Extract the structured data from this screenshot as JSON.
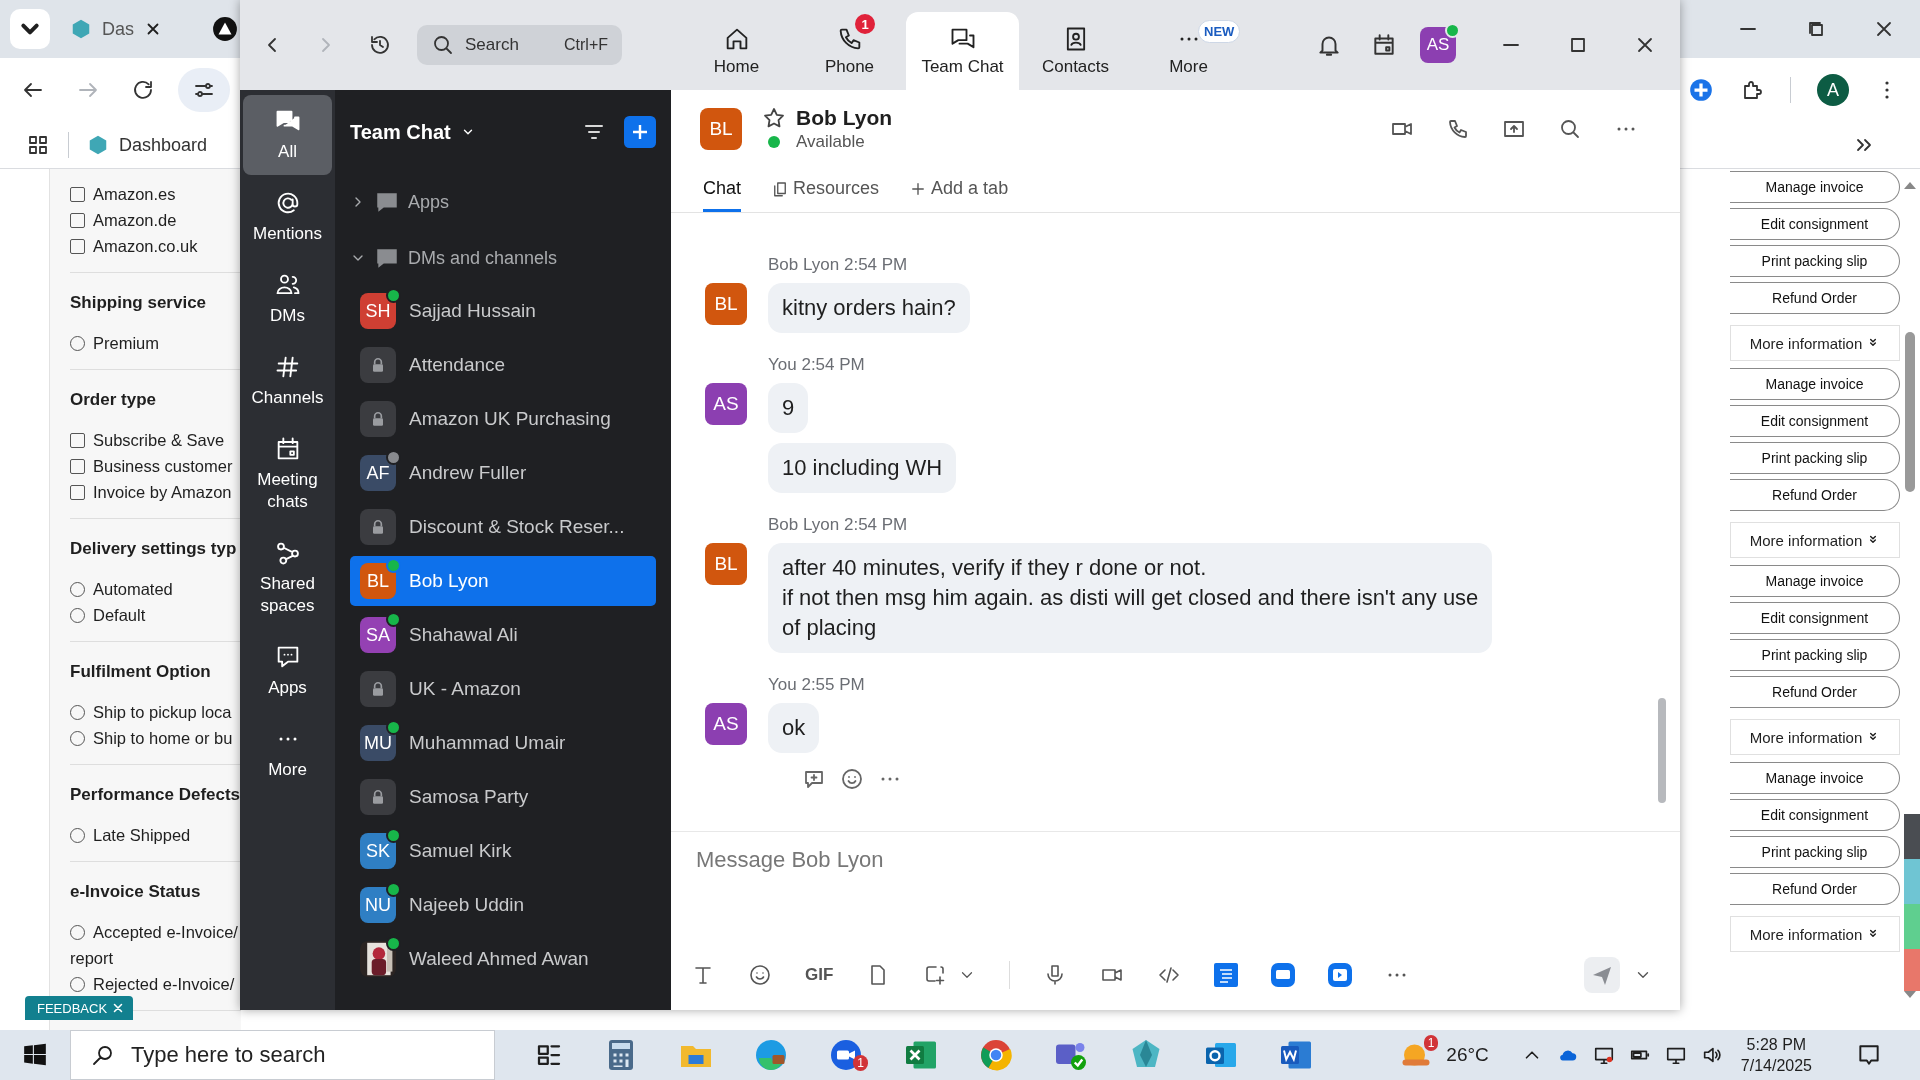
{
  "browser": {
    "tab_label": "Das",
    "bookmark": "Dashboard",
    "profile_initial": "A"
  },
  "filters": [
    {
      "options": [
        {
          "kind": "checkbox",
          "lines": [
            "Amazon.es"
          ],
          "checked": false
        },
        {
          "kind": "checkbox",
          "lines": [
            "Amazon.de"
          ],
          "checked": false
        },
        {
          "kind": "checkbox",
          "lines": [
            "Amazon.co.uk"
          ],
          "checked": false
        }
      ]
    },
    {
      "heading": "Shipping service",
      "options": [
        {
          "kind": "radio",
          "lines": [
            "Premium"
          ],
          "checked": false
        }
      ]
    },
    {
      "heading": "Order type",
      "options": [
        {
          "kind": "checkbox",
          "lines": [
            "Subscribe & Save"
          ],
          "checked": false
        },
        {
          "kind": "checkbox",
          "lines": [
            "Business customer"
          ],
          "checked": false
        },
        {
          "kind": "checkbox",
          "lines": [
            "Invoice by Amazon"
          ],
          "checked": false
        }
      ]
    },
    {
      "heading": "Delivery settings typ",
      "options": [
        {
          "kind": "radio",
          "lines": [
            "Automated"
          ],
          "checked": false
        },
        {
          "kind": "radio",
          "lines": [
            "Default"
          ],
          "checked": false
        }
      ]
    },
    {
      "heading": "Fulfilment Option",
      "options": [
        {
          "kind": "radio",
          "lines": [
            "Ship to pickup loca"
          ],
          "checked": false
        },
        {
          "kind": "radio",
          "lines": [
            "Ship to home or bu"
          ],
          "checked": false
        }
      ]
    },
    {
      "heading": "Performance Defects",
      "options": [
        {
          "kind": "radio",
          "lines": [
            "Late Shipped"
          ],
          "checked": false
        }
      ]
    },
    {
      "heading": "e-Invoice Status",
      "options": [
        {
          "kind": "radio",
          "lines": [
            "Accepted e-Invoice/",
            "report"
          ],
          "checked": false
        },
        {
          "kind": "radio",
          "lines": [
            "Rejected e-Invoice/"
          ],
          "checked": false
        }
      ]
    }
  ],
  "feedback": "FEEDBACK",
  "order_groups": [
    {
      "buttons": [
        "Manage invoice",
        "Edit consignment",
        "Print packing slip",
        "Refund Order"
      ]
    },
    {
      "header": "More information",
      "buttons": [
        "Manage invoice",
        "Edit consignment",
        "Print packing slip",
        "Refund Order"
      ]
    },
    {
      "header": "More information",
      "buttons": [
        "Manage invoice",
        "Edit consignment",
        "Print packing slip",
        "Refund Order"
      ]
    },
    {
      "header": "More information",
      "buttons": [
        "Manage invoice",
        "Edit consignment",
        "Print packing slip",
        "Refund Order"
      ]
    },
    {
      "header": "More information"
    }
  ],
  "zoom": {
    "search": {
      "placeholder": "Search",
      "shortcut": "Ctrl+F"
    },
    "nav": [
      {
        "label": "Home",
        "selected": false
      },
      {
        "label": "Phone",
        "selected": false,
        "badge": {
          "kind": "count",
          "text": "1"
        }
      },
      {
        "label": "Team Chat",
        "selected": true
      },
      {
        "label": "Contacts",
        "selected": false
      },
      {
        "label": "More",
        "selected": false,
        "badge": {
          "kind": "tag",
          "text": "NEW"
        }
      }
    ],
    "user": {
      "initials": "AS",
      "online": true
    },
    "rail": [
      {
        "label": "All",
        "selected": true
      },
      {
        "label": "Mentions",
        "selected": false
      },
      {
        "label": "DMs",
        "selected": false
      },
      {
        "label": "Channels",
        "selected": false
      },
      {
        "label": "Meeting chats",
        "selected": false
      },
      {
        "label": "Shared spaces",
        "selected": false
      },
      {
        "label": "Apps",
        "selected": false
      },
      {
        "label": "More",
        "selected": false
      }
    ],
    "list_title": "Team Chat",
    "sections": [
      {
        "label": "Apps",
        "expanded": false
      },
      {
        "label": "DMs and channels",
        "expanded": true
      }
    ],
    "conversations": [
      {
        "kind": "person",
        "name": "Sajjad Hussain",
        "initials": "SH",
        "color": "#cf3f33",
        "online": true,
        "selected": false
      },
      {
        "kind": "channel",
        "name": "Attendance",
        "selected": false
      },
      {
        "kind": "channel",
        "name": "Amazon UK Purchasing",
        "selected": false
      },
      {
        "kind": "person",
        "name": "Andrew Fuller",
        "initials": "AF",
        "color": "#3a4b66",
        "away": true,
        "selected": false
      },
      {
        "kind": "channel",
        "name": "Discount & Stock Reser...",
        "selected": false
      },
      {
        "kind": "person",
        "name": "Bob Lyon",
        "initials": "BL",
        "color": "#d1560e",
        "online": true,
        "selected": true
      },
      {
        "kind": "person",
        "name": "Shahawal Ali",
        "initials": "SA",
        "color": "#9441b3",
        "online": true,
        "selected": false
      },
      {
        "kind": "channel",
        "name": "UK - Amazon",
        "selected": false
      },
      {
        "kind": "person",
        "name": "Muhammad Umair",
        "initials": "MU",
        "color": "#3a4b66",
        "online": true,
        "selected": false
      },
      {
        "kind": "channel",
        "name": "Samosa Party",
        "selected": false
      },
      {
        "kind": "person",
        "name": "Samuel Kirk",
        "initials": "SK",
        "color": "#2f7fc4",
        "online": true,
        "selected": false
      },
      {
        "kind": "person",
        "name": "Najeeb Uddin",
        "initials": "NU",
        "color": "#2f7fc4",
        "online": true,
        "selected": false
      },
      {
        "name": "Waleed Ahmed Awan",
        "online": true,
        "selected": false
      }
    ],
    "chat": {
      "name": "Bob Lyon",
      "initials": "BL",
      "color": "#d1560e",
      "starred": false,
      "status": "Available",
      "tabs": [
        {
          "label": "Chat",
          "selected": true
        },
        {
          "label": "Resources",
          "selected": false
        }
      ],
      "add_tab": "Add a tab",
      "messages": [
        {
          "sender": "Bob Lyon",
          "time": "2:54 PM",
          "initials": "BL",
          "color": "#d1560e",
          "bubbles": [
            {
              "lines": [
                "kitny orders hain?"
              ]
            }
          ]
        },
        {
          "sender": "You",
          "time": "2:54 PM",
          "initials": "AS",
          "color": "#8c3fb1",
          "bubbles": [
            {
              "lines": [
                "9"
              ]
            },
            {
              "lines": [
                "10 including WH"
              ]
            }
          ]
        },
        {
          "sender": "Bob Lyon",
          "time": "2:54 PM",
          "initials": "BL",
          "color": "#d1560e",
          "bubbles": [
            {
              "lines": [
                "after 40 minutes, verify if they r done or not.",
                "if not then msg him again. as disti will get closed and there isn't any use",
                "of placing"
              ]
            }
          ]
        },
        {
          "sender": "You",
          "time": "2:55 PM",
          "initials": "AS",
          "color": "#8c3fb1",
          "bubbles": [
            {
              "lines": [
                "ok"
              ]
            }
          ]
        }
      ],
      "composer": {
        "placeholder": "Message Bob Lyon"
      },
      "gif": "GIF"
    }
  },
  "taskbar": {
    "search_placeholder": "Type here to search",
    "app_badge": "1",
    "weather_badge": "1",
    "temperature": "26°C",
    "time": "5:28 PM",
    "date": "7/14/2025"
  }
}
